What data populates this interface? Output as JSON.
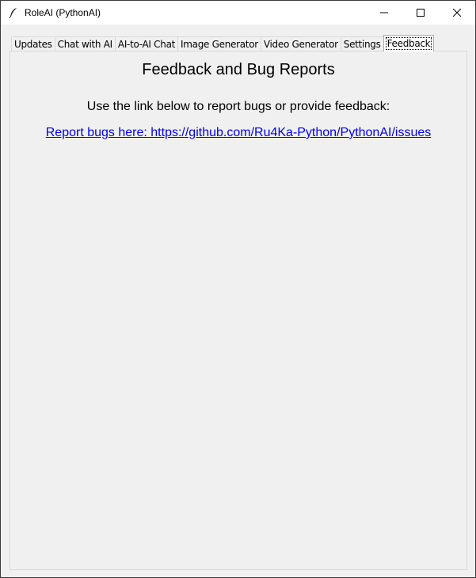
{
  "window": {
    "title": "RoleAI (PythonAI)",
    "app_icon": "feather-icon"
  },
  "tabs": [
    {
      "label": "Updates",
      "active": false
    },
    {
      "label": "Chat with AI",
      "active": false
    },
    {
      "label": "AI-to-AI Chat",
      "active": false
    },
    {
      "label": "Image Generator",
      "active": false
    },
    {
      "label": "Video Generator",
      "active": false
    },
    {
      "label": "Settings",
      "active": false
    },
    {
      "label": "Feedback",
      "active": true
    }
  ],
  "feedback": {
    "heading": "Feedback and Bug Reports",
    "instructions": "Use the link below to report bugs or provide feedback:",
    "link_text": "Report bugs here: https://github.com/Ru4Ka-Python/PythonAI/issues"
  },
  "colors": {
    "link": "#0000ee",
    "background": "#f0f0f0"
  }
}
